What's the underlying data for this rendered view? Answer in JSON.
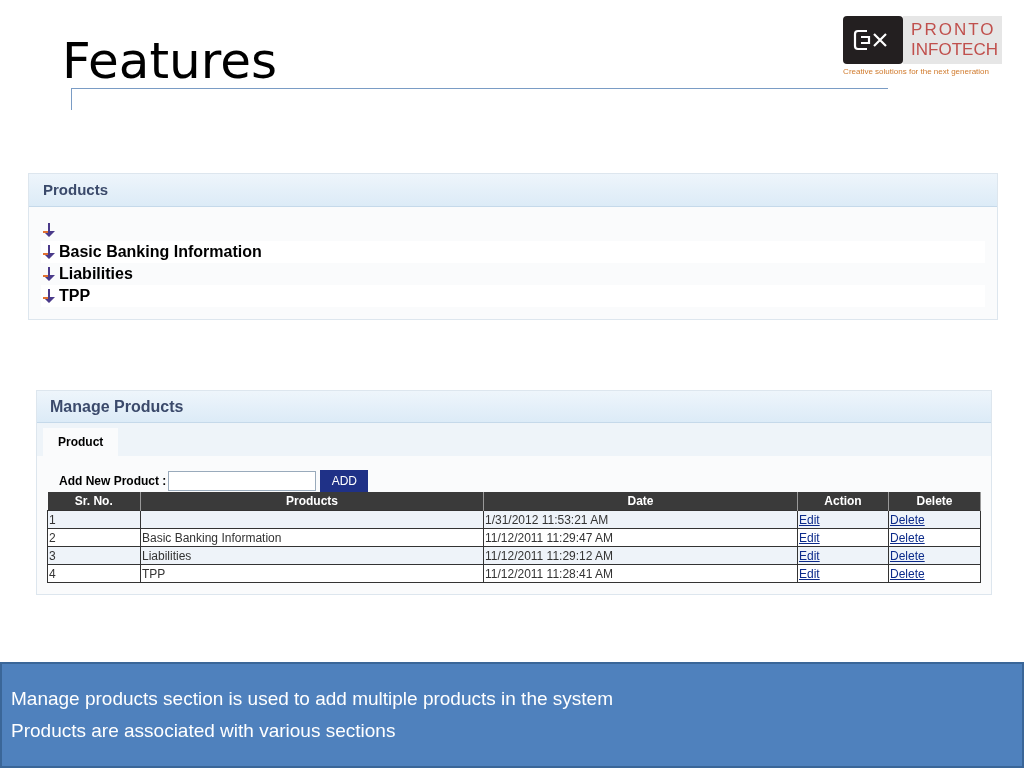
{
  "slide_title": "Features",
  "logo": {
    "brand_line_1": "PRONTO",
    "brand_line_2": "INFOTECH",
    "tagline": "Creative solutions for the next generation"
  },
  "products_panel": {
    "title": "Products",
    "items": [
      {
        "kind": "node"
      },
      {
        "kind": "node",
        "label": "Basic Banking Information"
      },
      {
        "kind": "node",
        "label": "Liabilities"
      },
      {
        "kind": "node",
        "label": "TPP"
      }
    ]
  },
  "manage_panel": {
    "title": "Manage Products",
    "tabs": [
      {
        "label": "Product",
        "selected": true
      }
    ],
    "add_label": "Add New Product :",
    "add_button": "ADD",
    "table": {
      "columns": [
        "Sr. No.",
        "Products",
        "Date",
        "Action",
        "Delete"
      ],
      "rows": [
        {
          "sr": "1",
          "date": "1/31/2012 11:53:21 AM",
          "action": "Edit",
          "delete": "Delete"
        },
        {
          "sr": "2",
          "product": "Basic Banking Information",
          "date": "11/12/2011 11:29:47 AM",
          "action": "Edit",
          "delete": "Delete"
        },
        {
          "sr": "3",
          "product": "Liabilities",
          "date": "11/12/2011 11:29:12 AM",
          "action": "Edit",
          "delete": "Delete"
        },
        {
          "sr": "4",
          "product": "TPP",
          "date": "11/12/2011 11:28:41 AM",
          "action": "Edit",
          "delete": "Delete"
        }
      ]
    }
  },
  "notes": [
    "Manage products section is used to add multiple products in the system",
    "Products are associated with various sections"
  ]
}
